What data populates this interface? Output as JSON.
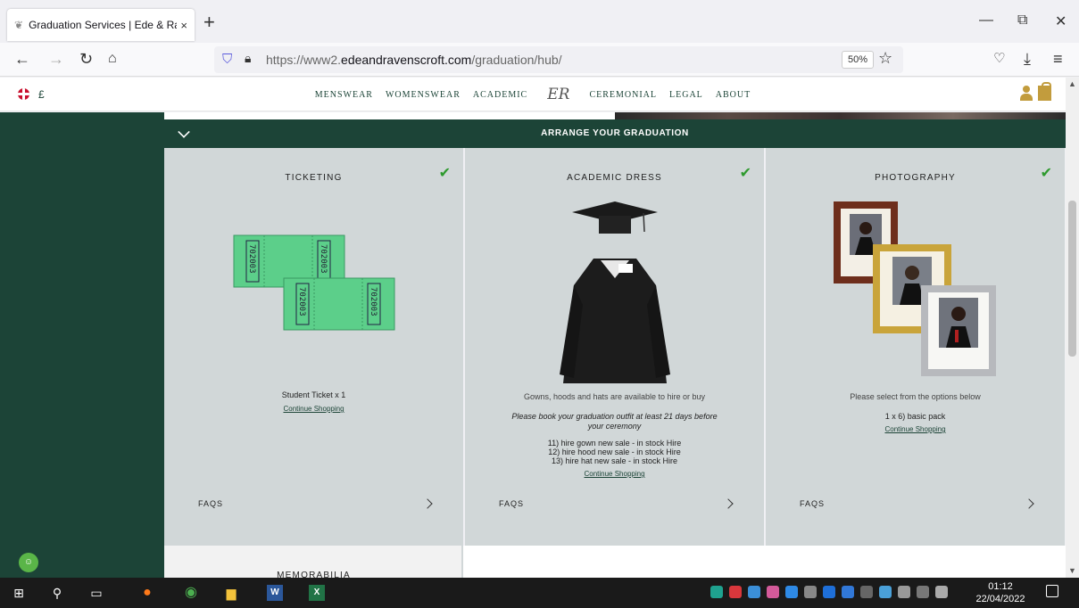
{
  "browser": {
    "tab_title": "Graduation Services | Ede & Rav",
    "tab_close": "×",
    "new_tab": "+",
    "url_prefix": "https://www2.",
    "url_domain": "edeandravenscroft.com",
    "url_path": "/graduation/hub/",
    "zoom": "50%",
    "win_min": "—",
    "win_restore": "⧉",
    "win_close": "✕"
  },
  "site": {
    "currency": "£",
    "logo": "ER",
    "menu": [
      "MENSWEAR",
      "WOMENSWEAR",
      "ACADEMIC",
      "CEREMONIAL",
      "LEGAL",
      "ABOUT"
    ]
  },
  "arrange": {
    "title": "ARRANGE YOUR GRADUATION"
  },
  "cards": {
    "ticketing": {
      "title": "TICKETING",
      "ticket_number": "702003",
      "item": "Student Ticket x 1",
      "link": "Continue Shopping",
      "faqs": "FAQS"
    },
    "academic": {
      "title": "ACADEMIC DRESS",
      "desc": "Gowns, hoods and hats are available to hire or buy",
      "note": "Please book your graduation outfit at least 21 days before your ceremony",
      "items": [
        "11) hire gown new sale - in stock Hire",
        "12) hire hood new sale - in stock Hire",
        "13) hire hat new sale - in stock Hire"
      ],
      "link": "Continue Shopping",
      "faqs": "FAQS"
    },
    "photography": {
      "title": "PHOTOGRAPHY",
      "desc": "Please select from the options below",
      "item": "1 x 6) basic pack",
      "link": "Continue Shopping",
      "faqs": "FAQS"
    },
    "memorabilia": {
      "title": "MEMORABILIA"
    }
  },
  "taskbar": {
    "time": "01:12",
    "date": "22/04/2022"
  },
  "colors": {
    "brand_green": "#1c4437",
    "card_bg": "#d1d7d8",
    "tick_green": "#2e9a2e",
    "gold": "#c29c3d"
  }
}
